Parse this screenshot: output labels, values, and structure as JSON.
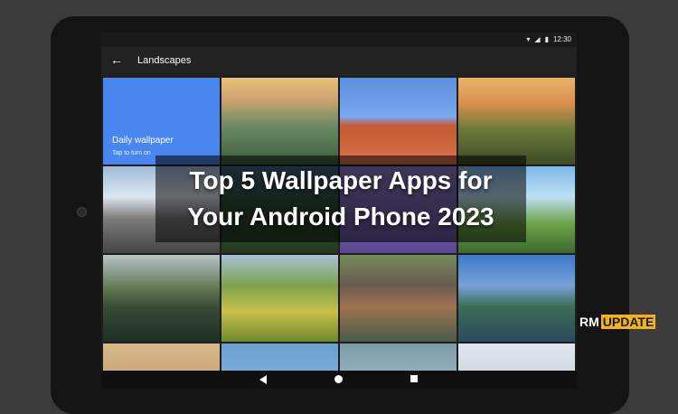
{
  "status": {
    "time": "12:30"
  },
  "appbar": {
    "title": "Landscapes"
  },
  "daily": {
    "label": "Daily wallpaper",
    "subtitle": "Tap to turn on"
  },
  "overlay": {
    "line1": "Top 5 Wallpaper Apps for",
    "line2": "Your Android Phone 2023"
  },
  "logo": {
    "part1": "RM",
    "part2": "UPDATE"
  },
  "tiles": [
    "sky-lake",
    "red-arch",
    "canyon-sunset",
    "mountain-snow",
    "lavender-field",
    "hill-green",
    "green-lake",
    "rice-terrace",
    "waterfall-rocks",
    "mountain-lake"
  ]
}
